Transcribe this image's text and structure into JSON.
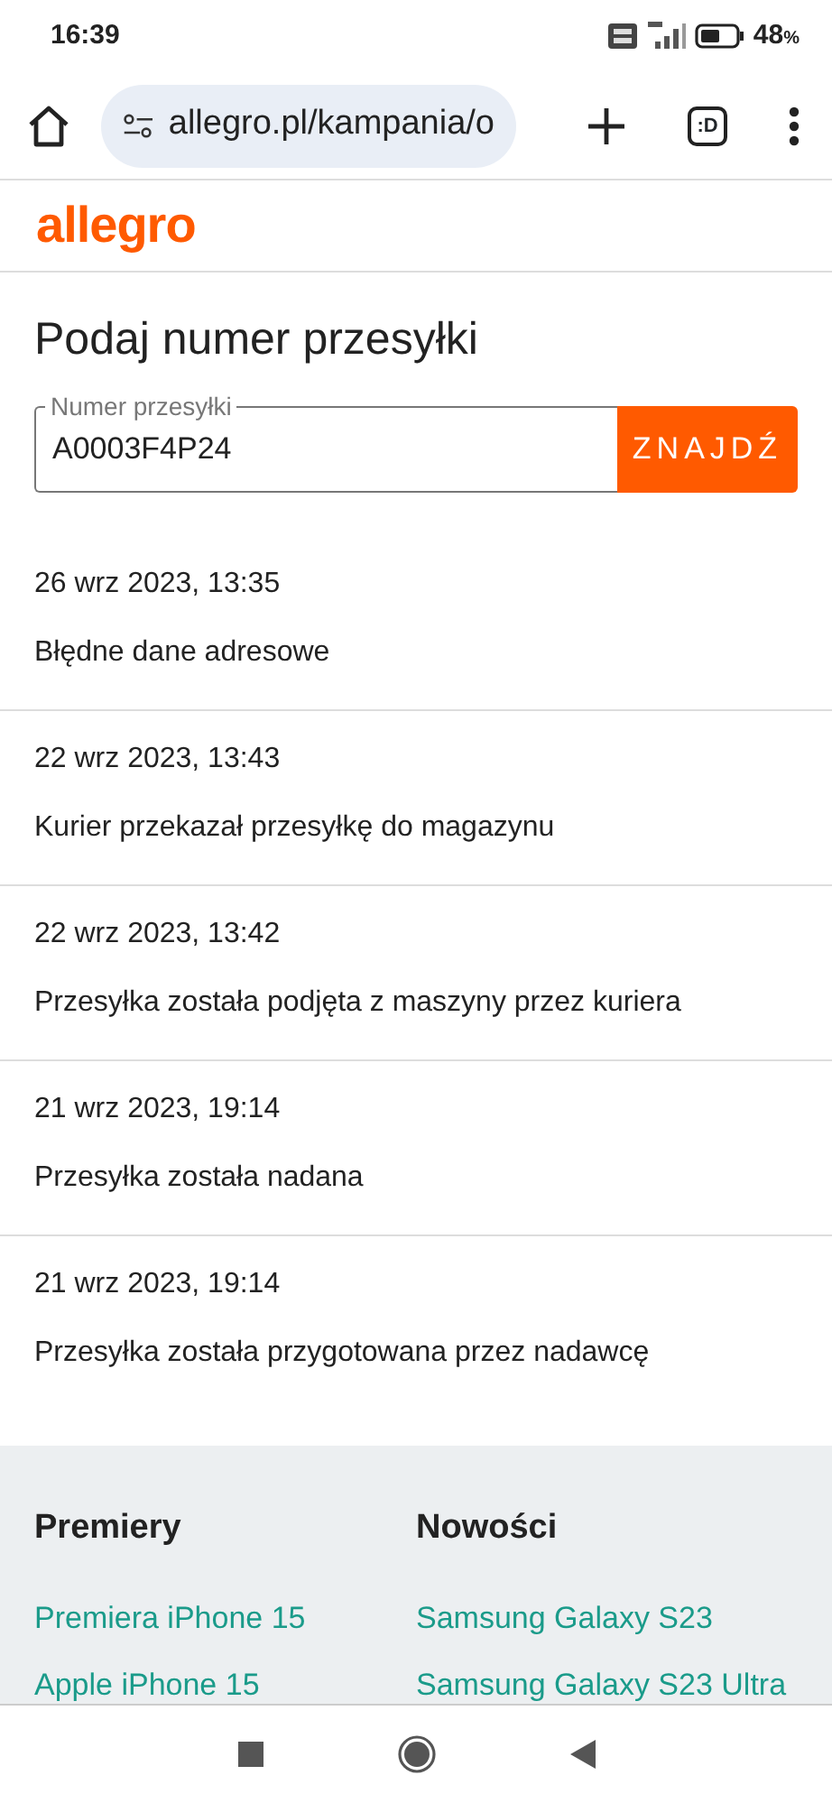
{
  "status_bar": {
    "time": "16:39",
    "battery_level": "48",
    "battery_unit": "%"
  },
  "browser": {
    "url": "allegro.pl/kampania/o",
    "tab_count": ":D"
  },
  "site": {
    "logo": "allegro"
  },
  "tracking": {
    "title": "Podaj numer przesyłki",
    "field_label": "Numer przesyłki",
    "value": "A0003F4P24",
    "button": "ZNAJDŹ"
  },
  "events": [
    {
      "time": "26 wrz 2023, 13:35",
      "status": "Błędne dane adresowe"
    },
    {
      "time": "22 wrz 2023, 13:43",
      "status": "Kurier przekazał przesyłkę do magazynu"
    },
    {
      "time": "22 wrz 2023, 13:42",
      "status": "Przesyłka została podjęta z maszyny przez kuriera"
    },
    {
      "time": "21 wrz 2023, 19:14",
      "status": "Przesyłka została nadana"
    },
    {
      "time": "21 wrz 2023, 19:14",
      "status": "Przesyłka została przygotowana przez nadawcę"
    }
  ],
  "footer": {
    "columns": [
      {
        "heading": "Premiery",
        "links": [
          "Premiera iPhone 15",
          "Apple iPhone 15"
        ]
      },
      {
        "heading": "Nowości",
        "links": [
          "Samsung Galaxy S23",
          "Samsung Galaxy S23 Ultra"
        ]
      }
    ]
  }
}
